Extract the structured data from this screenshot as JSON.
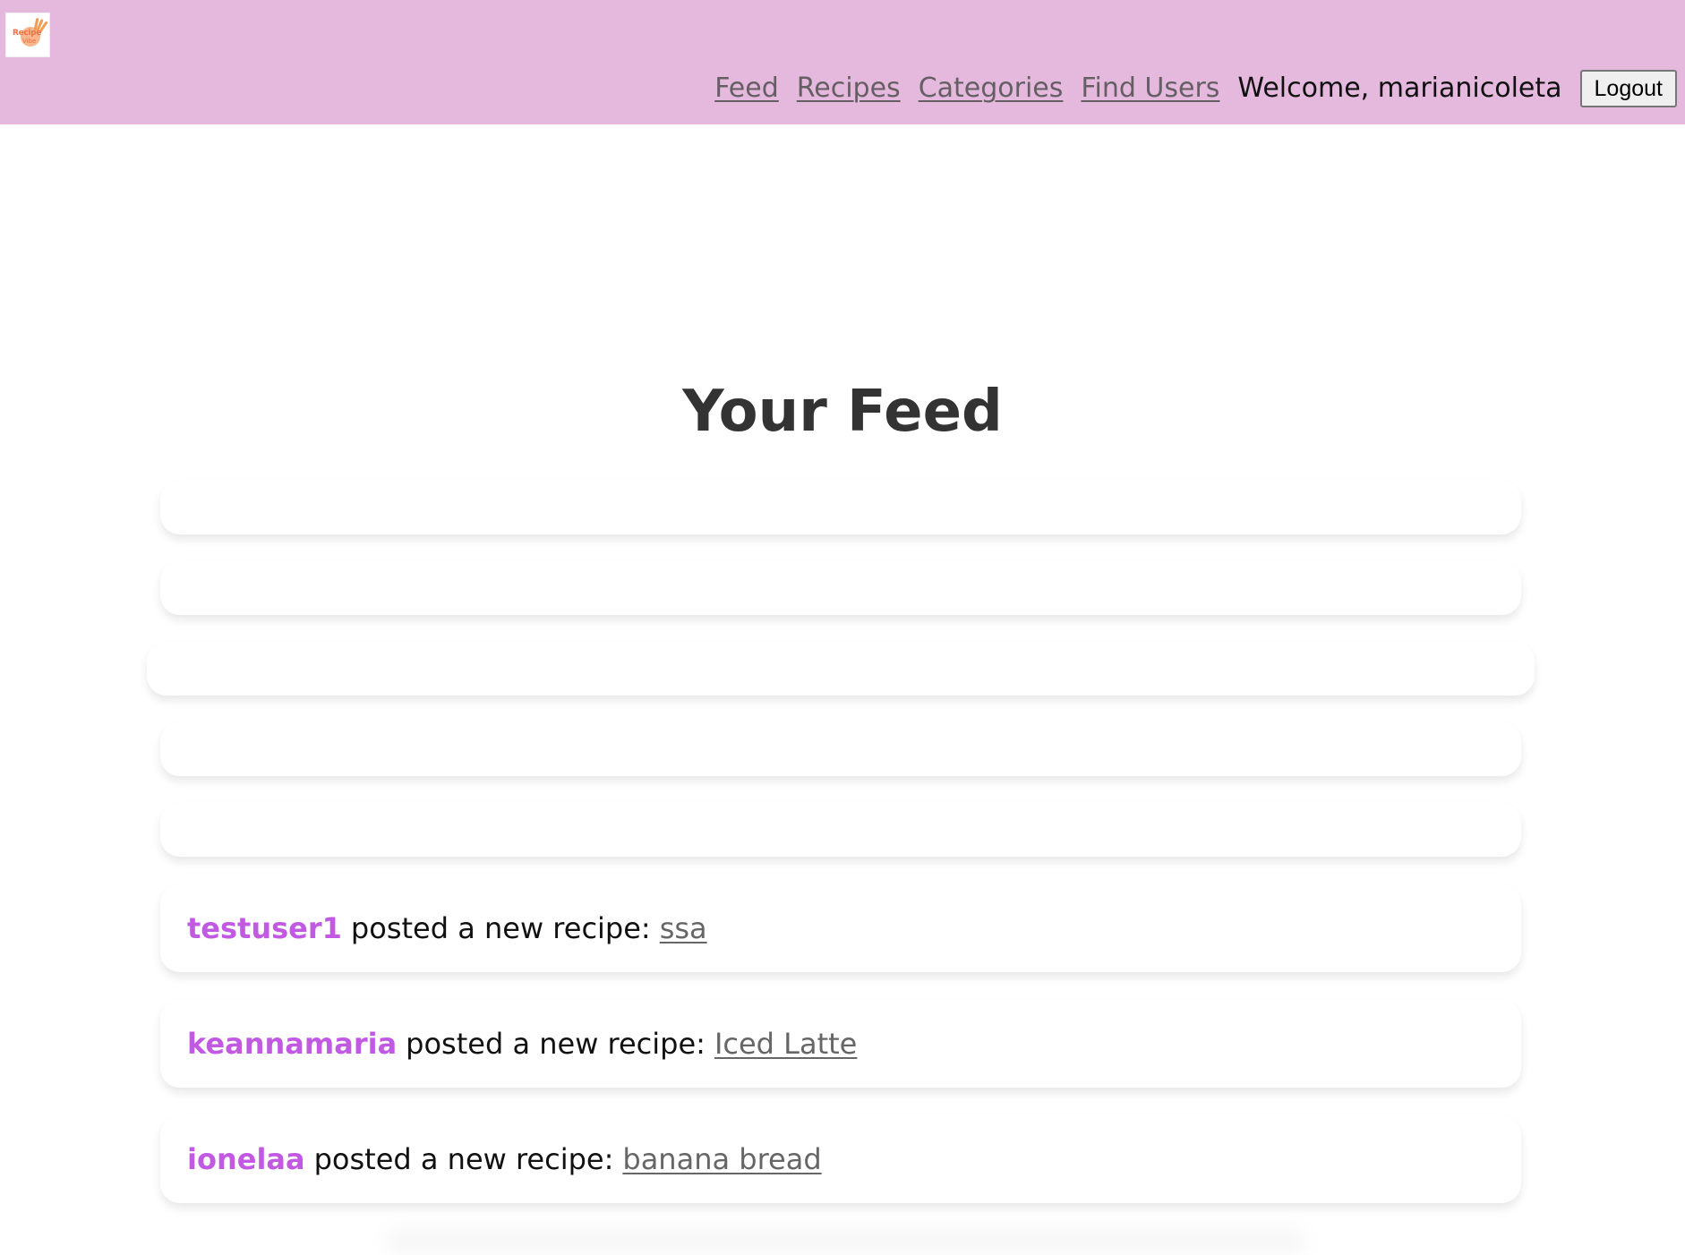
{
  "header": {
    "logo_title": "Recipe",
    "logo_subtitle": "Vibe",
    "nav": [
      {
        "label": "Feed"
      },
      {
        "label": "Recipes"
      },
      {
        "label": "Categories"
      },
      {
        "label": "Find Users"
      }
    ],
    "welcome_text": "Welcome, marianicoleta",
    "logout_label": "Logout",
    "background_color": "#e5b9de"
  },
  "main": {
    "title": "Your Feed",
    "feed_items": [
      {
        "username": "testuser1",
        "action": "posted a new recipe:",
        "recipe": "ssa"
      },
      {
        "username": "keannamaria",
        "action": "posted a new recipe:",
        "recipe": "Iced Latte"
      },
      {
        "username": "ionelaa",
        "action": "posted a new recipe:",
        "recipe": "banana bread"
      }
    ],
    "accent_color": "#c259e3"
  }
}
